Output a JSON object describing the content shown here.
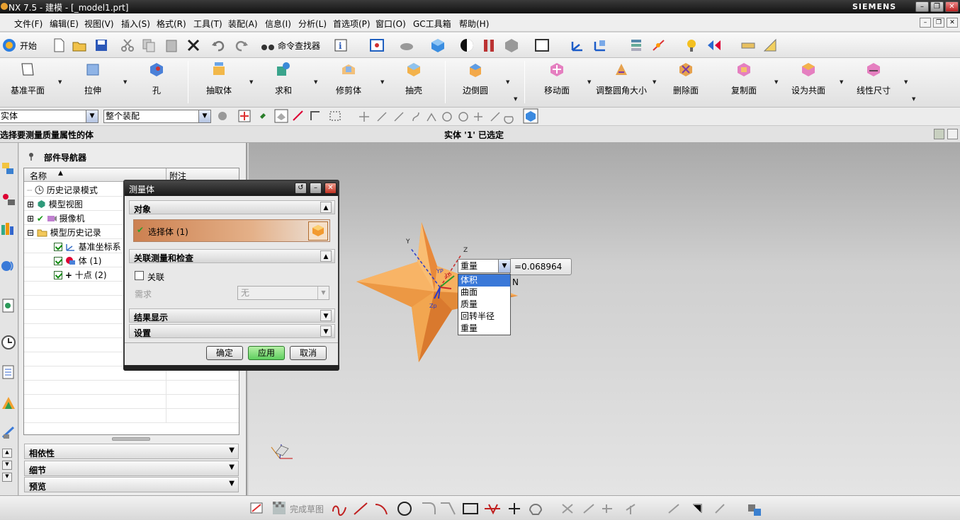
{
  "window": {
    "title": "NX 7.5 - 建模 - [_model1.prt]",
    "brand": "SIEMENS"
  },
  "menu": [
    "文件(F)",
    "编辑(E)",
    "视图(V)",
    "插入(S)",
    "格式(R)",
    "工具(T)",
    "装配(A)",
    "信息(I)",
    "分析(L)",
    "首选项(P)",
    "窗口(O)",
    "GC工具箱",
    "帮助(H)"
  ],
  "toolbar1": {
    "start_label": "开始",
    "command_finder": "命令查找器"
  },
  "toolbar2": [
    "基准平面",
    "拉伸",
    "孔",
    "抽取体",
    "求和",
    "修剪体",
    "抽壳",
    "边倒圆",
    "移动面",
    "调整圆角大小",
    "删除面",
    "复制面",
    "设为共面",
    "线性尺寸"
  ],
  "filter": {
    "type": "实体",
    "scope": "整个装配"
  },
  "status": {
    "prompt": "选择要测量质量属性的体",
    "message": "实体 '1' 已选定"
  },
  "navigator": {
    "title": "部件导航器",
    "col_name": "名称",
    "col_note": "附注",
    "nodes": [
      {
        "label": "历史记录模式"
      },
      {
        "label": "模型视图"
      },
      {
        "label": "摄像机"
      },
      {
        "label": "模型历史记录"
      },
      {
        "label": "基准坐标系 ("
      },
      {
        "label": "体 (1)"
      },
      {
        "label": "十点 (2)"
      }
    ],
    "panels": [
      "相依性",
      "细节",
      "预览"
    ]
  },
  "dialog": {
    "title": "测量体",
    "section_object": "对象",
    "select_body": "选择体 (1)",
    "section_assoc": "关联测量和检查",
    "assoc_label": "关联",
    "requirement_label": "需求",
    "requirement_value": "无",
    "section_results": "结果显示",
    "section_settings": "设置",
    "ok": "确定",
    "apply": "应用",
    "cancel": "取消"
  },
  "measure_popup": {
    "selected": "重量",
    "value": "=0.068964 N",
    "options": [
      "体积",
      "曲面",
      "质量",
      "回转半径",
      "重量"
    ],
    "highlighted_index": 0
  },
  "triad_labels": {
    "y": "Y",
    "z": "Z",
    "yp": "YP",
    "xp": "XP",
    "zp": "Zp"
  },
  "sketch_toolbar": {
    "finish_sketch": "完成草图"
  },
  "colors": {
    "part": "#f5a24a",
    "highlight": "#3a78d8",
    "apply_green": "#5fcf5f",
    "dialog_bar": "#d4915e"
  }
}
